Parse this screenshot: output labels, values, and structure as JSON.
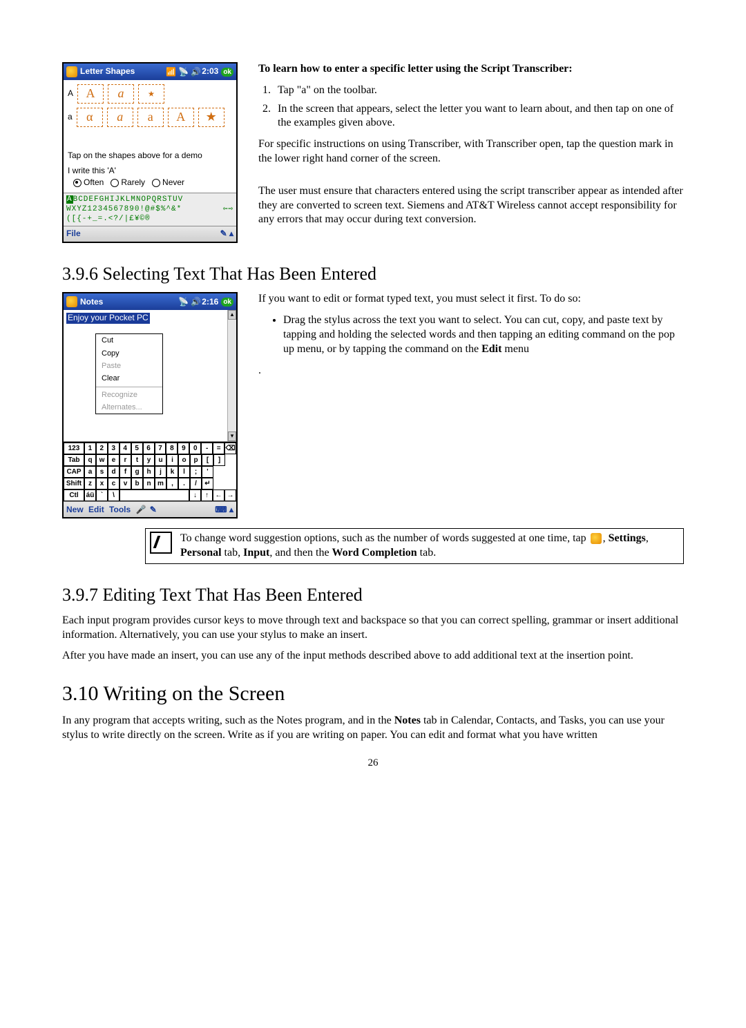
{
  "pda1": {
    "title": "Letter Shapes",
    "time": "2:03",
    "ok": "ok",
    "upperLabel": "A",
    "lowerLabel": "a",
    "demoHint": "Tap on the shapes above for a demo",
    "iwrite": "I write this 'A'",
    "radios": {
      "often": "Often",
      "rarely": "Rarely",
      "never": "Never"
    },
    "strip1": "BCDEFGHIJKLMNOPQRSTUV",
    "strip1_hl": "A",
    "strip2": "WXYZ1234567890!@#$%^&*",
    "strip3_left": "([{-+_=.<?/|£¥©®",
    "bottom": "File"
  },
  "right1": {
    "heading": "To learn how to enter a specific letter using the Script Transcriber:",
    "step1": "Tap \"a\" on the toolbar.",
    "step2": "In the screen that appears, select the letter you want to learn about, and then tap on one of the examples given above.",
    "para1": "For specific instructions on using Transcriber, with Transcriber open, tap the question mark in the lower right hand corner of the screen.",
    "para2": "The user must ensure that characters entered using the script transcriber appear as intended after they are converted to screen text.  Siemens and AT&T Wireless cannot accept responsibility for any errors that may occur during text conversion."
  },
  "h396": "3.9.6 Selecting Text That Has Been Entered",
  "pda2": {
    "title": "Notes",
    "time": "2:16",
    "ok": "ok",
    "noteText": "Enjoy your Pocket PC",
    "menu": {
      "cut": "Cut",
      "copy": "Copy",
      "paste": "Paste",
      "clear": "Clear",
      "recognize": "Recognize",
      "alternates": "Alternates..."
    },
    "kbRow0": [
      "123",
      "1",
      "2",
      "3",
      "4",
      "5",
      "6",
      "7",
      "8",
      "9",
      "0",
      "-",
      "=",
      "⌫"
    ],
    "kbRow1": [
      "Tab",
      "q",
      "w",
      "e",
      "r",
      "t",
      "y",
      "u",
      "i",
      "o",
      "p",
      "[",
      "]"
    ],
    "kbRow2": [
      "CAP",
      "a",
      "s",
      "d",
      "f",
      "g",
      "h",
      "j",
      "k",
      "l",
      ";",
      "'"
    ],
    "kbRow3": [
      "Shift",
      "z",
      "x",
      "c",
      "v",
      "b",
      "n",
      "m",
      ",",
      ".",
      "/",
      "↵"
    ],
    "kbRow4": [
      "Ctl",
      "áü",
      "`",
      "\\",
      " ",
      "↓",
      "↑",
      "←",
      "→"
    ],
    "bottom": [
      "New",
      "Edit",
      "Tools"
    ]
  },
  "right2": {
    "intro": "If you want to edit or format typed text, you must select it first. To do so:",
    "bullet_a": "Drag the stylus across the text you want to select. You can cut, copy, and paste text by tapping and holding the selected words and then tapping an editing command on the pop up menu, or by tapping the command on the ",
    "bullet_b": "Edit",
    "bullet_c": " menu"
  },
  "tip": {
    "text_a": "To change word suggestion options, such as the number of words suggested at one time, tap ",
    "text_b": ", ",
    "settings": "Settings",
    "comma1": ", ",
    "personal": "Personal",
    "tab1": " tab, ",
    "input": "Input",
    "andthen": ", and then the ",
    "wordcomp": "Word Completion",
    "tab2": " tab."
  },
  "h397": "3.9.7 Editing Text That Has Been Entered",
  "p397a": "Each input program provides cursor keys to move through text and backspace so that you can correct spelling, grammar or insert additional information. Alternatively, you can use your stylus to make an insert.",
  "p397b": "After you have made an insert, you can use any of the input methods described above to add additional text at the insertion point.",
  "h310": "3.10 Writing on the Screen",
  "p310_a": "In any program that accepts writing, such as the Notes program, and in the ",
  "p310_b": "Notes",
  "p310_c": " tab in Calendar, Contacts, and Tasks, you can use your stylus to write directly on the screen. Write as if you are writing on paper. You can edit and format what you have written",
  "pageNum": "26"
}
